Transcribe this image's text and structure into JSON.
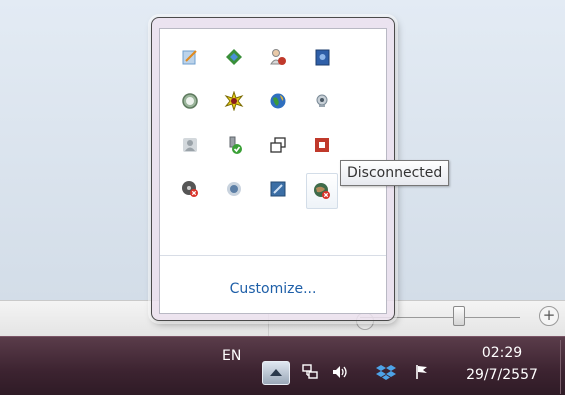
{
  "popup": {
    "customize_label": "Customize...",
    "icons": [
      {
        "name": "pencil-notepad-icon",
        "color": "#6f9fcf"
      },
      {
        "name": "green-blue-diamond-icon",
        "color": "#3a8f3a"
      },
      {
        "name": "user-red-badge-icon",
        "color": "#c0392b"
      },
      {
        "name": "blue-book-icon",
        "color": "#2f5fa8"
      },
      {
        "name": "gear-ring-icon",
        "color": "#6f8a6f"
      },
      {
        "name": "sun-burst-icon",
        "color": "#d4b000"
      },
      {
        "name": "globe-icon",
        "color": "#2e7d32"
      },
      {
        "name": "webcam-icon",
        "color": "#7a8a96"
      },
      {
        "name": "person-gray-icon",
        "color": "#9aa2a8"
      },
      {
        "name": "usb-check-icon",
        "color": "#3aa036"
      },
      {
        "name": "overlapping-windows-icon",
        "color": "#333333"
      },
      {
        "name": "red-square-icon",
        "color": "#c0392b"
      },
      {
        "name": "disc-error-icon",
        "color": "#555555"
      },
      {
        "name": "blue-circle-icon",
        "color": "#5d7fa6"
      },
      {
        "name": "screen-blue-icon",
        "color": "#3b6ea5"
      },
      {
        "name": "network-disconnected-icon",
        "color": "#6a5a4a"
      }
    ]
  },
  "tooltip": {
    "text": "Disconnected"
  },
  "taskbar": {
    "language": "EN",
    "time": "02:29",
    "date": "29/7/2557",
    "tray_icons": [
      "network-icon",
      "volume-icon",
      "dropbox-icon",
      "action-center-flag-icon"
    ]
  },
  "zoom": {
    "plus_label": "+"
  }
}
